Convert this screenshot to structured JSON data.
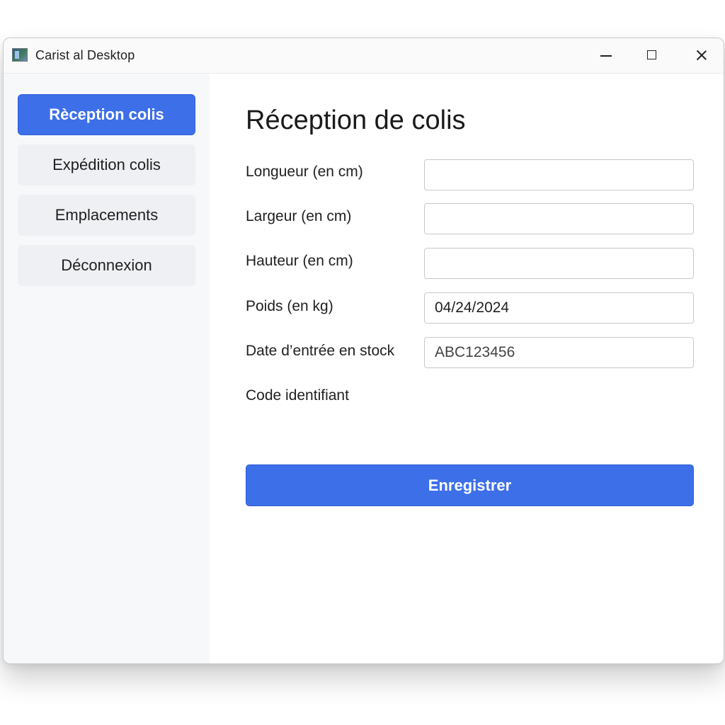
{
  "window": {
    "title": "Carist al Desktop",
    "icon": "app-window-icon",
    "controls": [
      "minimize-icon",
      "maximize-icon",
      "close-icon"
    ]
  },
  "sidebar": {
    "items": [
      {
        "label": "Rèception colis",
        "active": true
      },
      {
        "label": "Expédition colis",
        "active": false
      },
      {
        "label": "Emplacements",
        "active": false
      },
      {
        "label": "Déconnexion",
        "active": false
      }
    ]
  },
  "main": {
    "title": "Réception de colis",
    "labels": {
      "longueur": "Longueur (en cm)",
      "largeur": "Largeur (en cm)",
      "hauteur": "Hauteur (en cm)",
      "poids": "Poids (en kg)",
      "date": "Date d’entrée en stock",
      "code": "Code identifiant"
    },
    "inputs": {
      "longueur": "",
      "largeur": "",
      "hauteur": "",
      "poids": "04/24/2024",
      "date": "ABC123456"
    },
    "submit_label": "Enregistrer"
  },
  "colors": {
    "accent": "#3d6fe9",
    "sidebar_bg": "#f7f8fa",
    "nav_item_bg": "#eef0f3"
  }
}
